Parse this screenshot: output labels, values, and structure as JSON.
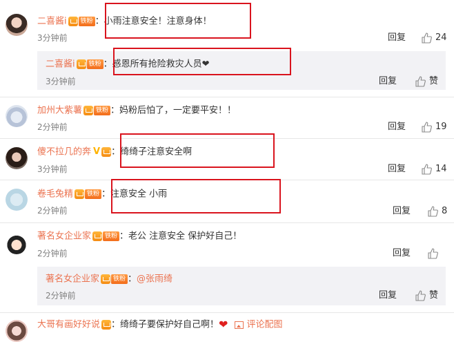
{
  "colors": {
    "username": "#eb7350",
    "badge": "#f36d1b",
    "highlight_box": "#d9131d",
    "sub_bg": "#f2f2f5"
  },
  "fan_label": "铁粉",
  "reply_label": "回复",
  "praise_label": "赞",
  "comments": [
    {
      "user": "二喜酱i",
      "text": "：小雨注意安全！注意身体！",
      "time": "3分钟前",
      "likes": "24",
      "sub": {
        "user": "二喜酱i",
        "text": "：感恩所有抢险救灾人员",
        "time": "3分钟前"
      }
    },
    {
      "user": "加州大紫薯",
      "text": "：妈粉后怕了，一定要平安！！",
      "time": "2分钟前",
      "likes": "19"
    },
    {
      "user": "傻不拉几的奔",
      "text": "：绮绮子注意安全啊",
      "time": "3分钟前",
      "likes": "14"
    },
    {
      "user": "卷毛兔精",
      "text": "：注意安全 小雨",
      "time": "2分钟前",
      "likes": "8"
    },
    {
      "user": "著名女企业家",
      "text": "：老公 注意安全 保护好自己！",
      "time": "2分钟前",
      "likes": "",
      "sub": {
        "user": "著名女企业家",
        "text": "：",
        "mention": "@张雨绮",
        "time": "2分钟前"
      }
    },
    {
      "user": "大哥有画好好说",
      "text": "：绮绮子要保护好自己啊！",
      "peek_label": "评论配图"
    }
  ]
}
